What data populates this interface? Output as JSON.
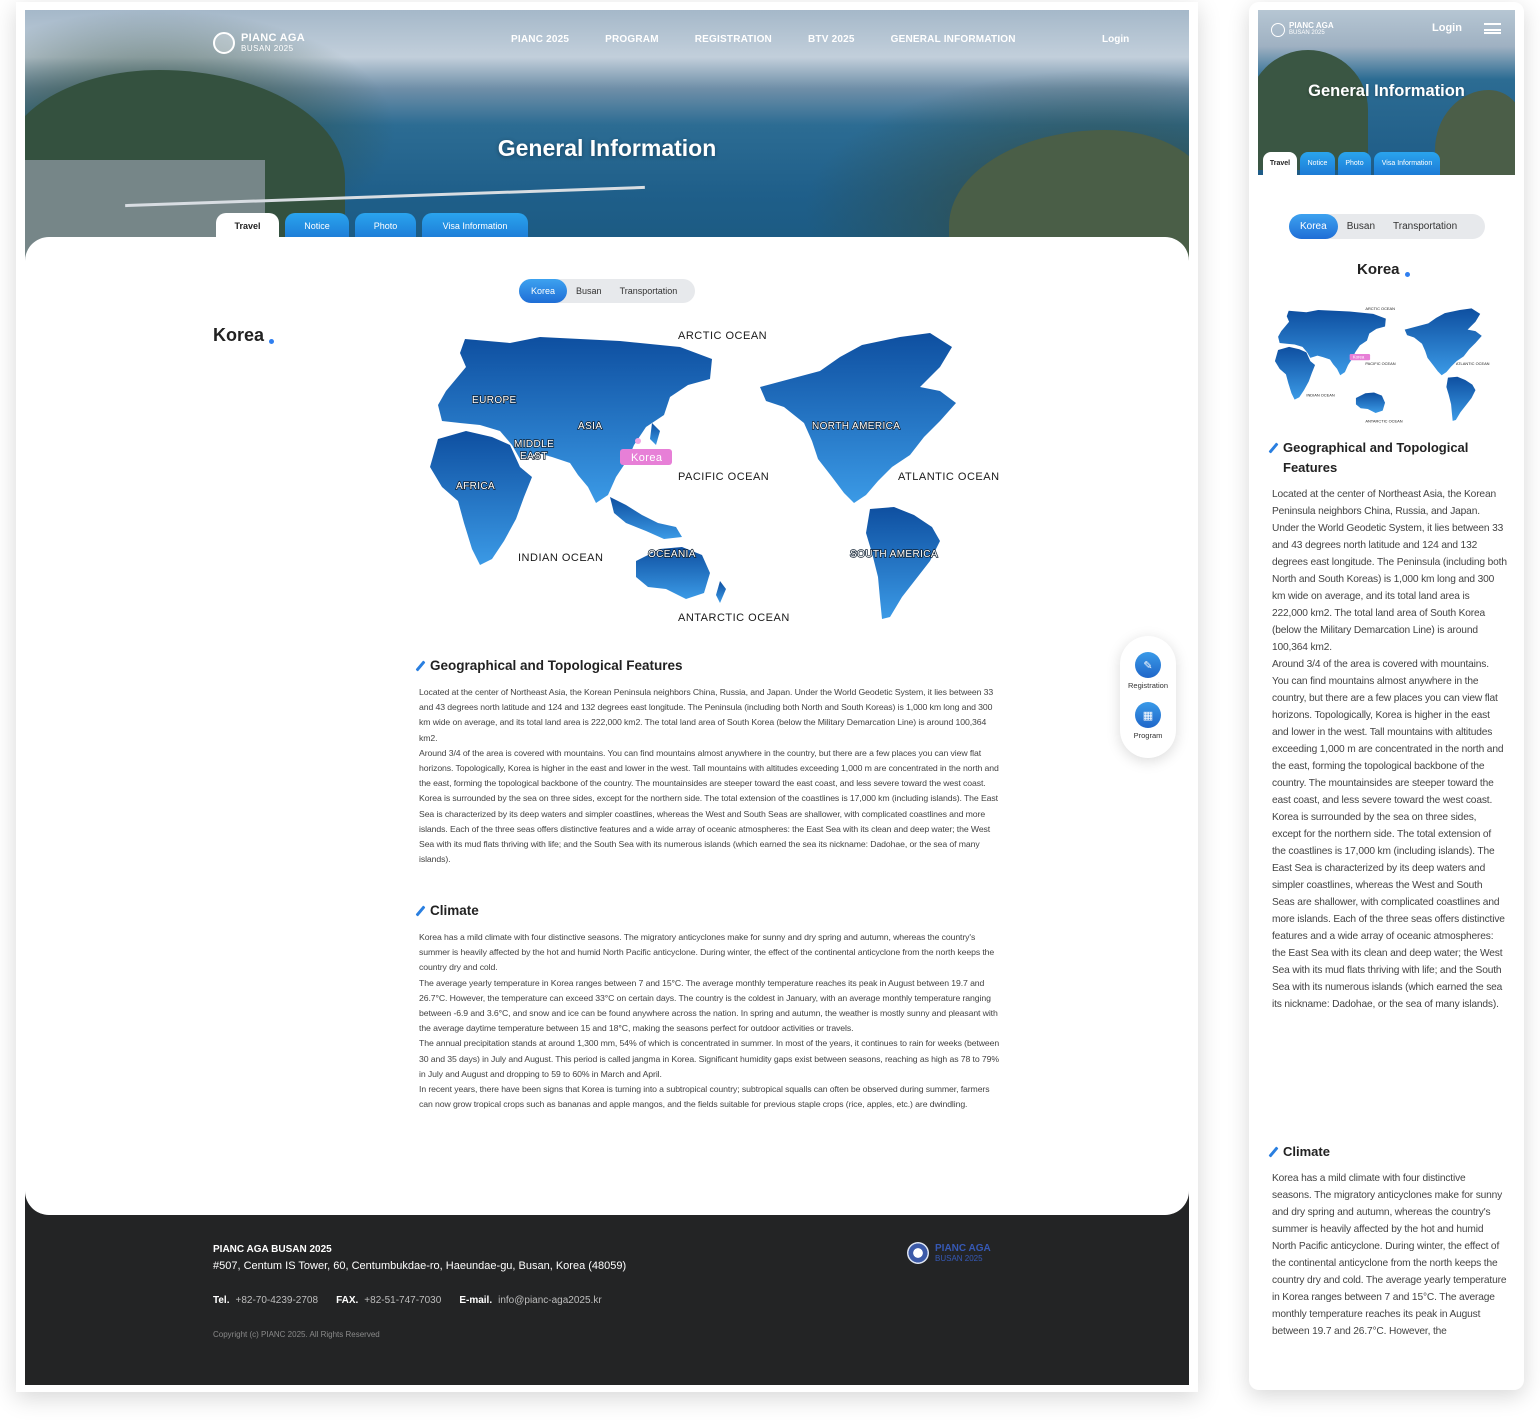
{
  "site": {
    "logo_line1": "PIANC AGA",
    "logo_line2": "BUSAN 2025",
    "nav": [
      "PIANC 2025",
      "PROGRAM",
      "REGISTRATION",
      "BTV 2025",
      "GENERAL INFORMATION"
    ],
    "login": "Login",
    "hero_title": "General Information"
  },
  "tabs": [
    "Travel",
    "Notice",
    "Photo",
    "Visa Information"
  ],
  "active_tab": "Travel",
  "segment": [
    "Korea",
    "Busan",
    "Transportation"
  ],
  "active_segment": "Korea",
  "page_heading": "Korea",
  "map": {
    "oceans": [
      "ARCTIC OCEAN",
      "PACIFIC OCEAN",
      "ATLANTIC OCEAN",
      "INDIAN OCEAN",
      "ANTARCTIC OCEAN"
    ],
    "continents": [
      "EUROPE",
      "ASIA",
      "MIDDLE",
      "EAST",
      "AFRICA",
      "OCEANIA",
      "NORTH AMERICA",
      "SOUTH AMERICA"
    ],
    "highlight": "Korea"
  },
  "sections": [
    {
      "title": "Geographical and Topological Features",
      "paragraphs": [
        "Located at the center of Northeast Asia, the Korean Peninsula neighbors China, Russia, and Japan. Under the World Geodetic System, it lies between 33 and 43 degrees north latitude and 124 and 132 degrees east longitude. The Peninsula (including both North and South Koreas) is 1,000 km long and 300 km wide on average, and its total land area is 222,000 km2. The total land area of South Korea (below the Military Demarcation Line) is around 100,364 km2.",
        "Around 3/4 of the area is covered with mountains. You can find mountains almost anywhere in the country, but there are a few places you can view flat horizons. Topologically, Korea is higher in the east and lower in the west. Tall mountains with altitudes exceeding 1,000 m are concentrated in the north and the east, forming the topological backbone of the country. The mountainsides are steeper toward the east coast, and less severe toward the west coast.",
        "Korea is surrounded by the sea on three sides, except for the northern side. The total extension of the coastlines is 17,000 km (including islands). The East Sea is characterized by its deep waters and simpler coastlines, whereas the West and South Seas are shallower, with complicated coastlines and more islands. Each of the three seas offers distinctive features and a wide array of oceanic atmospheres: the East Sea with its clean and deep water; the West Sea with its mud flats thriving with life; and the South Sea with its numerous islands (which earned the sea its nickname: Dadohae, or the sea of many islands)."
      ]
    },
    {
      "title": "Climate",
      "paragraphs": [
        "Korea has a mild climate with four distinctive seasons. The migratory anticyclones make for sunny and dry spring and autumn, whereas the country's summer is heavily affected by the hot and humid North Pacific anticyclone. During winter, the effect of the continental anticyclone from the north keeps the country dry and cold.",
        "The average yearly temperature in Korea ranges between 7 and 15°C. The average monthly temperature reaches its peak in August between 19.7 and 26.7°C. However, the temperature can exceed 33°C on certain days. The country is the coldest in January, with an average monthly temperature ranging between -6.9 and 3.6°C, and snow and ice can be found anywhere across the nation. In spring and autumn, the weather is mostly sunny and pleasant with the average daytime temperature between 15 and 18°C, making the seasons perfect for outdoor activities or travels.",
        "The annual precipitation stands at around 1,300 mm, 54% of which is concentrated in summer. In most of the years, it continues to rain for weeks (between 30 and 35 days) in July and August. This period is called jangma in Korea. Significant humidity gaps exist between seasons, reaching as high as 78 to 79% in July and August and dropping to 59 to 60% in March and April.",
        "In recent years, there have been signs that Korea is turning into a subtropical country; subtropical squalls can often be observed during summer, farmers can now grow tropical crops such as bananas and apple mangos, and the fields suitable for previous staple crops (rice, apples, etc.) are dwindling."
      ]
    }
  ],
  "mobile_climate_excerpt": "Korea has a mild climate with four distinctive seasons. The migratory anticyclones make for sunny and dry spring and autumn, whereas the country's summer is heavily affected by the hot and humid North Pacific anticyclone. During winter, the effect of the continental anticyclone from the north keeps the country dry and cold. The average yearly temperature in Korea ranges between 7 and 15°C. The average monthly temperature reaches its peak in August between 19.7 and 26.7°C. However, the",
  "float_menu": [
    "Registration",
    "Program"
  ],
  "footer": {
    "name": "PIANC AGA BUSAN 2025",
    "address": "#507, Centum IS Tower, 60, Centumbukdae-ro, Haeundae-gu, Busan, Korea (48059)",
    "tel_label": "Tel.",
    "tel": "+82-70-4239-2708",
    "fax_label": "FAX.",
    "fax": "+82-51-747-7030",
    "email_label": "E-mail.",
    "email": "info@pianc-aga2025.kr",
    "copyright": "Copyright (c) PIANC 2025. All Rights Reserved",
    "logo_line1": "PIANC AGA",
    "logo_line2": "BUSAN 2025"
  },
  "colors": {
    "accent": "#1f6ed6",
    "tab_blue": "#2aa4ee",
    "footer_bg": "#232425",
    "korea_pin": "#e77fd7",
    "land_dark": "#0e4fa0",
    "land_light": "#3b9ae6"
  }
}
